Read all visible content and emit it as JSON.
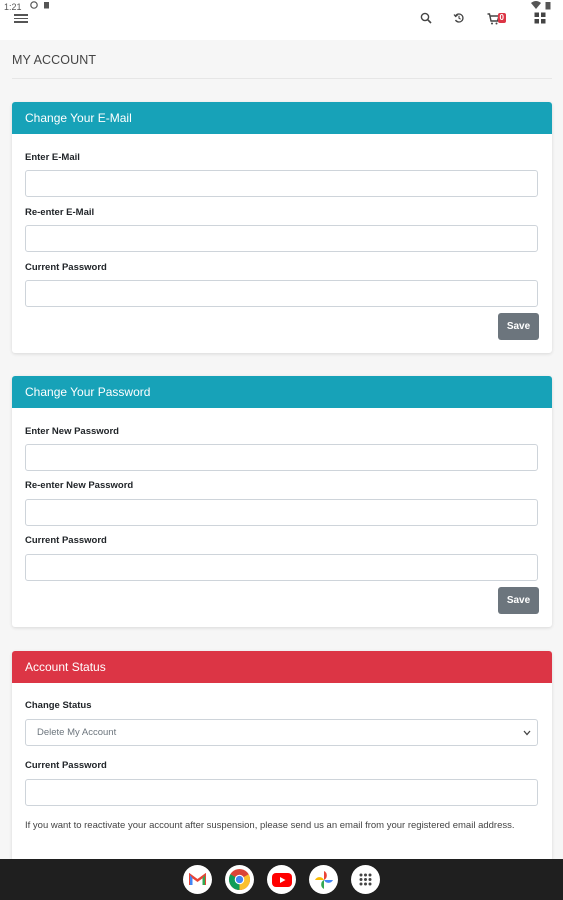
{
  "status_bar": {
    "time": "1:21"
  },
  "header": {
    "cart_count": "0"
  },
  "page_title": "MY ACCOUNT",
  "email_card": {
    "title": "Change Your E-Mail",
    "enter_email_label": "Enter E-Mail",
    "enter_email_value": "",
    "reenter_email_label": "Re-enter E-Mail",
    "reenter_email_value": "",
    "current_password_label": "Current Password",
    "current_password_value": "",
    "save_label": "Save"
  },
  "password_card": {
    "title": "Change Your Password",
    "new_password_label": "Enter New Password",
    "new_password_value": "",
    "reenter_password_label": "Re-enter New Password",
    "reenter_password_value": "",
    "current_password_label": "Current Password",
    "current_password_value": "",
    "save_label": "Save"
  },
  "status_card": {
    "title": "Account Status",
    "change_status_label": "Change Status",
    "change_status_selected": "Delete My Account",
    "current_password_label": "Current Password",
    "current_password_value": "",
    "note": "If you want to reactivate your account after suspension, please send us an email from your registered email address."
  },
  "colors": {
    "teal_header": "#17a2b8",
    "red_header": "#dc3545",
    "save_button": "#6c757d"
  },
  "dock_apps": [
    "gmail-icon",
    "chrome-icon",
    "youtube-icon",
    "photos-icon",
    "app-drawer-icon"
  ]
}
